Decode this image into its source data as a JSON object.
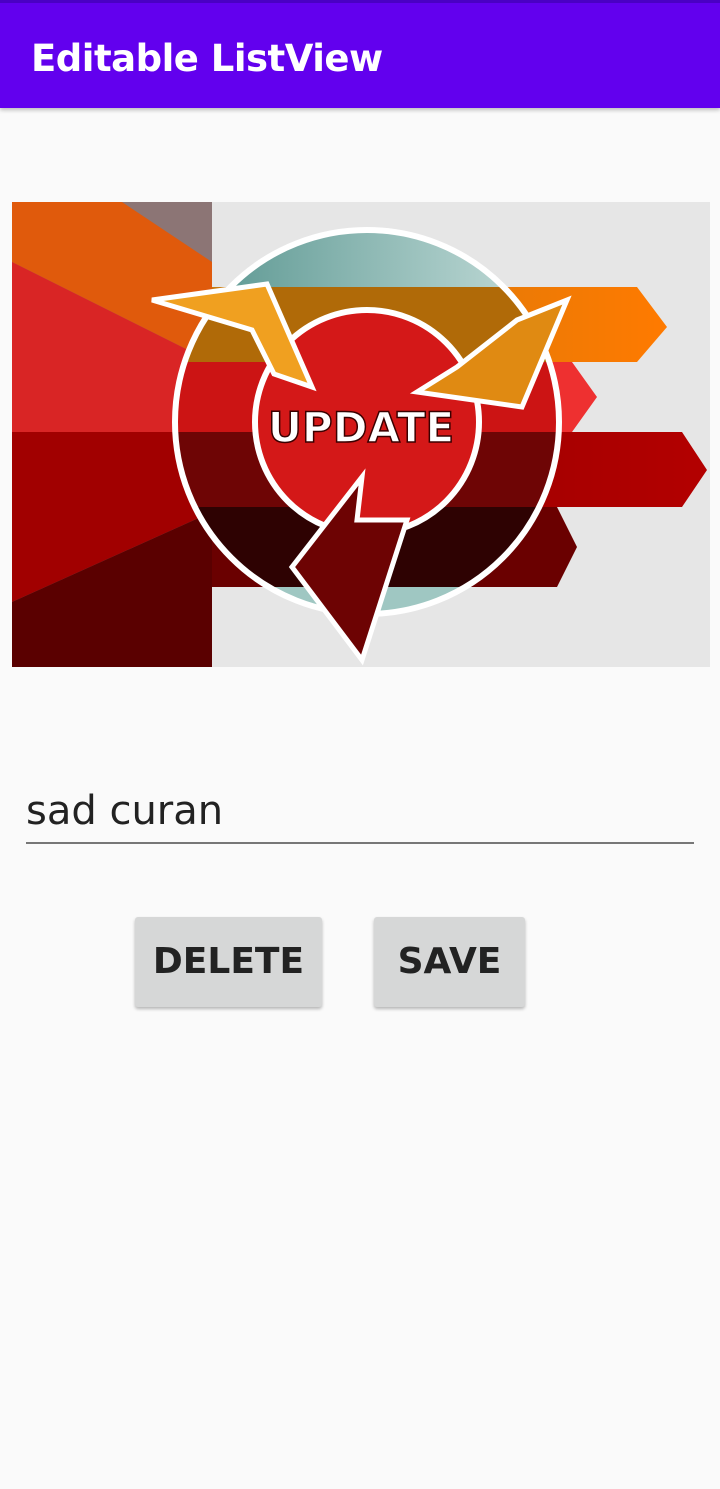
{
  "app_bar": {
    "title": "Editable ListView",
    "color": "#6200ee"
  },
  "banner": {
    "text": "UPDATE"
  },
  "form": {
    "name_value": "sad curan"
  },
  "buttons": {
    "delete_label": "DELETE",
    "save_label": "SAVE"
  },
  "colors": {
    "background": "#fafafa",
    "button": "#d6d7d7"
  }
}
